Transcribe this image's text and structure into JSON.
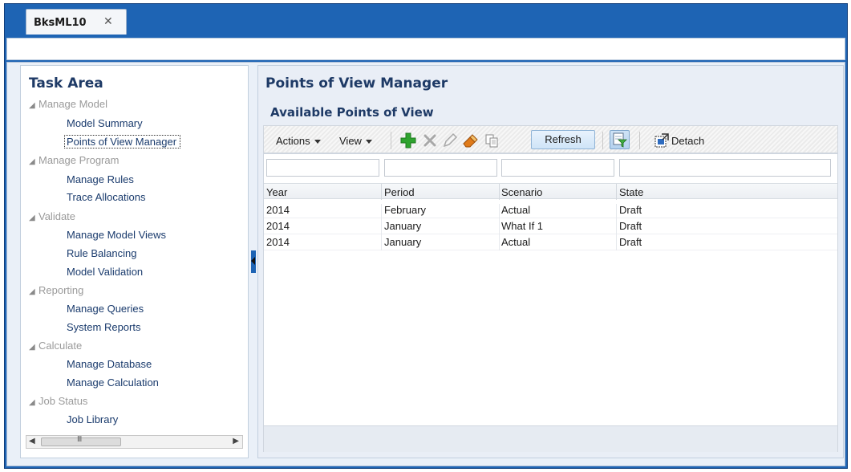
{
  "tab": {
    "title": "BksML10",
    "close": "✕"
  },
  "task_area": {
    "title": "Task Area",
    "sections": [
      {
        "label": "Manage Model",
        "items": [
          "Model Summary",
          "Points of View Manager"
        ]
      },
      {
        "label": "Manage Program",
        "items": [
          "Manage Rules",
          "Trace Allocations"
        ]
      },
      {
        "label": "Validate",
        "items": [
          "Manage Model Views",
          "Rule Balancing",
          "Model Validation"
        ]
      },
      {
        "label": "Reporting",
        "items": [
          "Manage Queries",
          "System Reports"
        ]
      },
      {
        "label": "Calculate",
        "items": [
          "Manage Database",
          "Manage Calculation"
        ]
      },
      {
        "label": "Job Status",
        "items": [
          "Job Library"
        ]
      }
    ],
    "selected_item": "Points of View Manager",
    "scroll_grip": "III"
  },
  "main": {
    "title": "Points of View Manager",
    "subtitle": "Available Points of View"
  },
  "toolbar": {
    "actions_label": "Actions",
    "view_label": "View",
    "refresh_label": "Refresh",
    "detach_label": "Detach",
    "icons": [
      "add-icon",
      "delete-icon",
      "edit-icon",
      "clear-icon",
      "copy-icon",
      "query-by-example-icon",
      "detach-icon"
    ]
  },
  "table": {
    "columns": [
      "Year",
      "Period",
      "Scenario",
      "State"
    ],
    "rows": [
      [
        "2014",
        "February",
        "Actual",
        "Draft"
      ],
      [
        "2014",
        "January",
        "What If 1",
        "Draft"
      ],
      [
        "2014",
        "January",
        "Actual",
        "Draft"
      ]
    ]
  },
  "colors": {
    "frame_blue": "#1e64b4",
    "heading_navy": "#1e3a66",
    "link_blue": "#1a3b6d",
    "add_green": "#2ea32e"
  }
}
